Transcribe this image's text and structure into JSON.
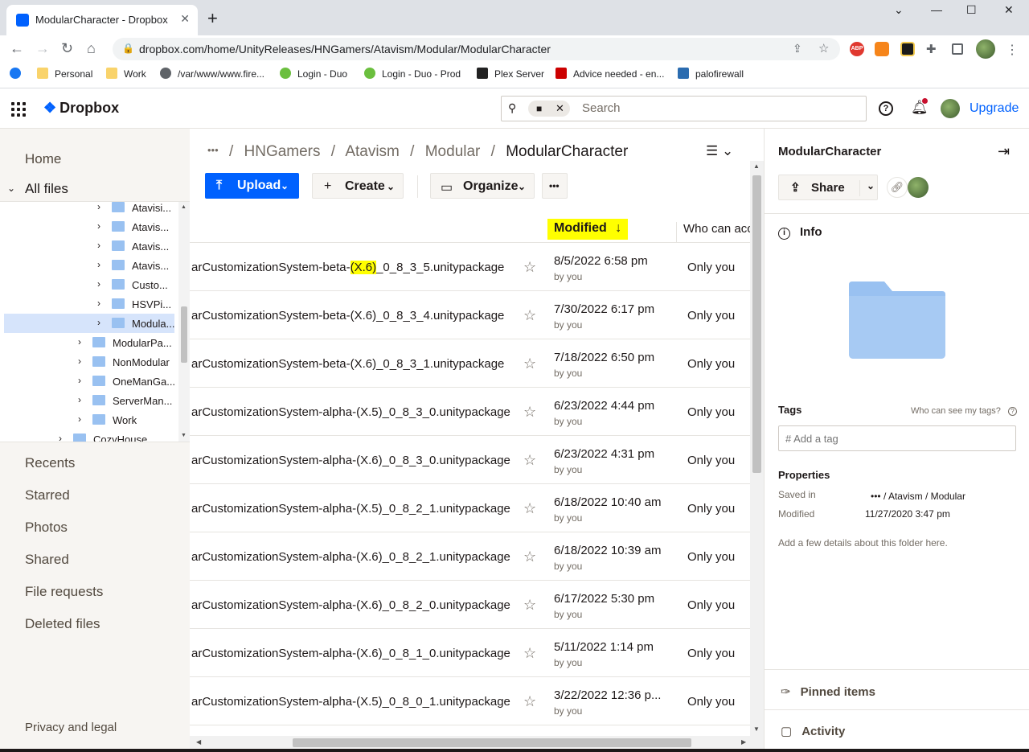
{
  "browser": {
    "tab_title": "ModularCharacter - Dropbox",
    "tab_close": "✕",
    "new_tab": "+",
    "url": "dropbox.com/home/UnityReleases/HNGamers/Atavism/Modular/ModularCharacter",
    "window_controls": [
      "⌄",
      "—",
      "☐",
      "✕"
    ],
    "bookmarks": [
      "Personal",
      "Work",
      "/var/www/www.fire...",
      "Login - Duo",
      "Login - Duo - Prod",
      "Plex Server",
      "Advice needed - en...",
      "palofirewall"
    ],
    "extensions": {
      "abp": "ABP"
    }
  },
  "header": {
    "logo": "Dropbox",
    "search_placeholder": "Search",
    "upgrade": "Upgrade",
    "icons": [
      "apps-grid-icon",
      "search-icon",
      "help-icon",
      "bell-icon",
      "avatar"
    ]
  },
  "sidebar": {
    "top": [
      "Home",
      "All files"
    ],
    "tree": [
      {
        "label": "Atavisi...",
        "level": 2
      },
      {
        "label": "Atavis...",
        "level": 2
      },
      {
        "label": "Atavis...",
        "level": 2
      },
      {
        "label": "Atavis...",
        "level": 2
      },
      {
        "label": "Custo...",
        "level": 2
      },
      {
        "label": "HSVPi...",
        "level": 2
      },
      {
        "label": "Modula...",
        "level": 2,
        "selected": true
      },
      {
        "label": "ModularPa...",
        "level": 1
      },
      {
        "label": "NonModular",
        "level": 1
      },
      {
        "label": "OneManGa...",
        "level": 1
      },
      {
        "label": "ServerMan...",
        "level": 1
      },
      {
        "label": "Work",
        "level": 1
      },
      {
        "label": "CozyHouse",
        "level": 0
      }
    ],
    "bottom": [
      "Recents",
      "Starred",
      "Photos",
      "Shared",
      "File requests",
      "Deleted files"
    ],
    "privacy": "Privacy and legal"
  },
  "main": {
    "breadcrumb": {
      "ellipsis": "•••",
      "items": [
        "HNGamers",
        "Atavism",
        "Modular"
      ],
      "current": "ModularCharacter",
      "sep": "/"
    },
    "buttons": {
      "upload": "Upload",
      "create": "Create",
      "organize": "Organize",
      "more": "•••"
    },
    "columns": {
      "modified": "Modified",
      "who": "Who can acc"
    },
    "files": [
      {
        "name_pre": "arCustomizationSystem-beta-",
        "name_hl": "(X.6)",
        "name_post": "_0_8_3_5.unitypackage",
        "date": "8/5/2022 6:58 pm",
        "by": "by you",
        "who": "Only you"
      },
      {
        "name_pre": "arCustomizationSystem-beta-(X.6)_0_8_3_4.unitypackage",
        "name_hl": "",
        "name_post": "",
        "date": "7/30/2022 6:17 pm",
        "by": "by you",
        "who": "Only you"
      },
      {
        "name_pre": "arCustomizationSystem-beta-(X.6)_0_8_3_1.unitypackage",
        "name_hl": "",
        "name_post": "",
        "date": "7/18/2022 6:50 pm",
        "by": "by you",
        "who": "Only you"
      },
      {
        "name_pre": "arCustomizationSystem-alpha-(X.5)_0_8_3_0.unitypackage",
        "name_hl": "",
        "name_post": "",
        "date": "6/23/2022 4:44 pm",
        "by": "by you",
        "who": "Only you"
      },
      {
        "name_pre": "arCustomizationSystem-alpha-(X.6)_0_8_3_0.unitypackage",
        "name_hl": "",
        "name_post": "",
        "date": "6/23/2022 4:31 pm",
        "by": "by you",
        "who": "Only you"
      },
      {
        "name_pre": "arCustomizationSystem-alpha-(X.5)_0_8_2_1.unitypackage",
        "name_hl": "",
        "name_post": "",
        "date": "6/18/2022 10:40 am",
        "by": "by you",
        "who": "Only you"
      },
      {
        "name_pre": "arCustomizationSystem-alpha-(X.6)_0_8_2_1.unitypackage",
        "name_hl": "",
        "name_post": "",
        "date": "6/18/2022 10:39 am",
        "by": "by you",
        "who": "Only you"
      },
      {
        "name_pre": "arCustomizationSystem-alpha-(X.6)_0_8_2_0.unitypackage",
        "name_hl": "",
        "name_post": "",
        "date": "6/17/2022 5:30 pm",
        "by": "by you",
        "who": "Only you"
      },
      {
        "name_pre": "arCustomizationSystem-alpha-(X.6)_0_8_1_0.unitypackage",
        "name_hl": "",
        "name_post": "",
        "date": "5/11/2022 1:14 pm",
        "by": "by you",
        "who": "Only you"
      },
      {
        "name_pre": "arCustomizationSystem-alpha-(X.5)_0_8_0_1.unitypackage",
        "name_hl": "",
        "name_post": "",
        "date": "3/22/2022 12:36 p...",
        "by": "by you",
        "who": "Only you"
      }
    ]
  },
  "panel": {
    "title": "ModularCharacter",
    "share": "Share",
    "info": "Info",
    "tags_label": "Tags",
    "tags_help": "Who can see my tags?",
    "tag_placeholder": "# Add a tag",
    "properties": "Properties",
    "saved_in_label": "Saved in",
    "saved_in_value": "•••  /  Atavism  /  Modular",
    "modified_label": "Modified",
    "modified_value": "11/27/2020 3:47 pm",
    "details": "Add a few details about this folder here.",
    "pinned": "Pinned items",
    "activity": "Activity"
  },
  "colors": {
    "accent": "#0061fe",
    "highlight": "#ffff00",
    "folder": "#99c1f1"
  }
}
